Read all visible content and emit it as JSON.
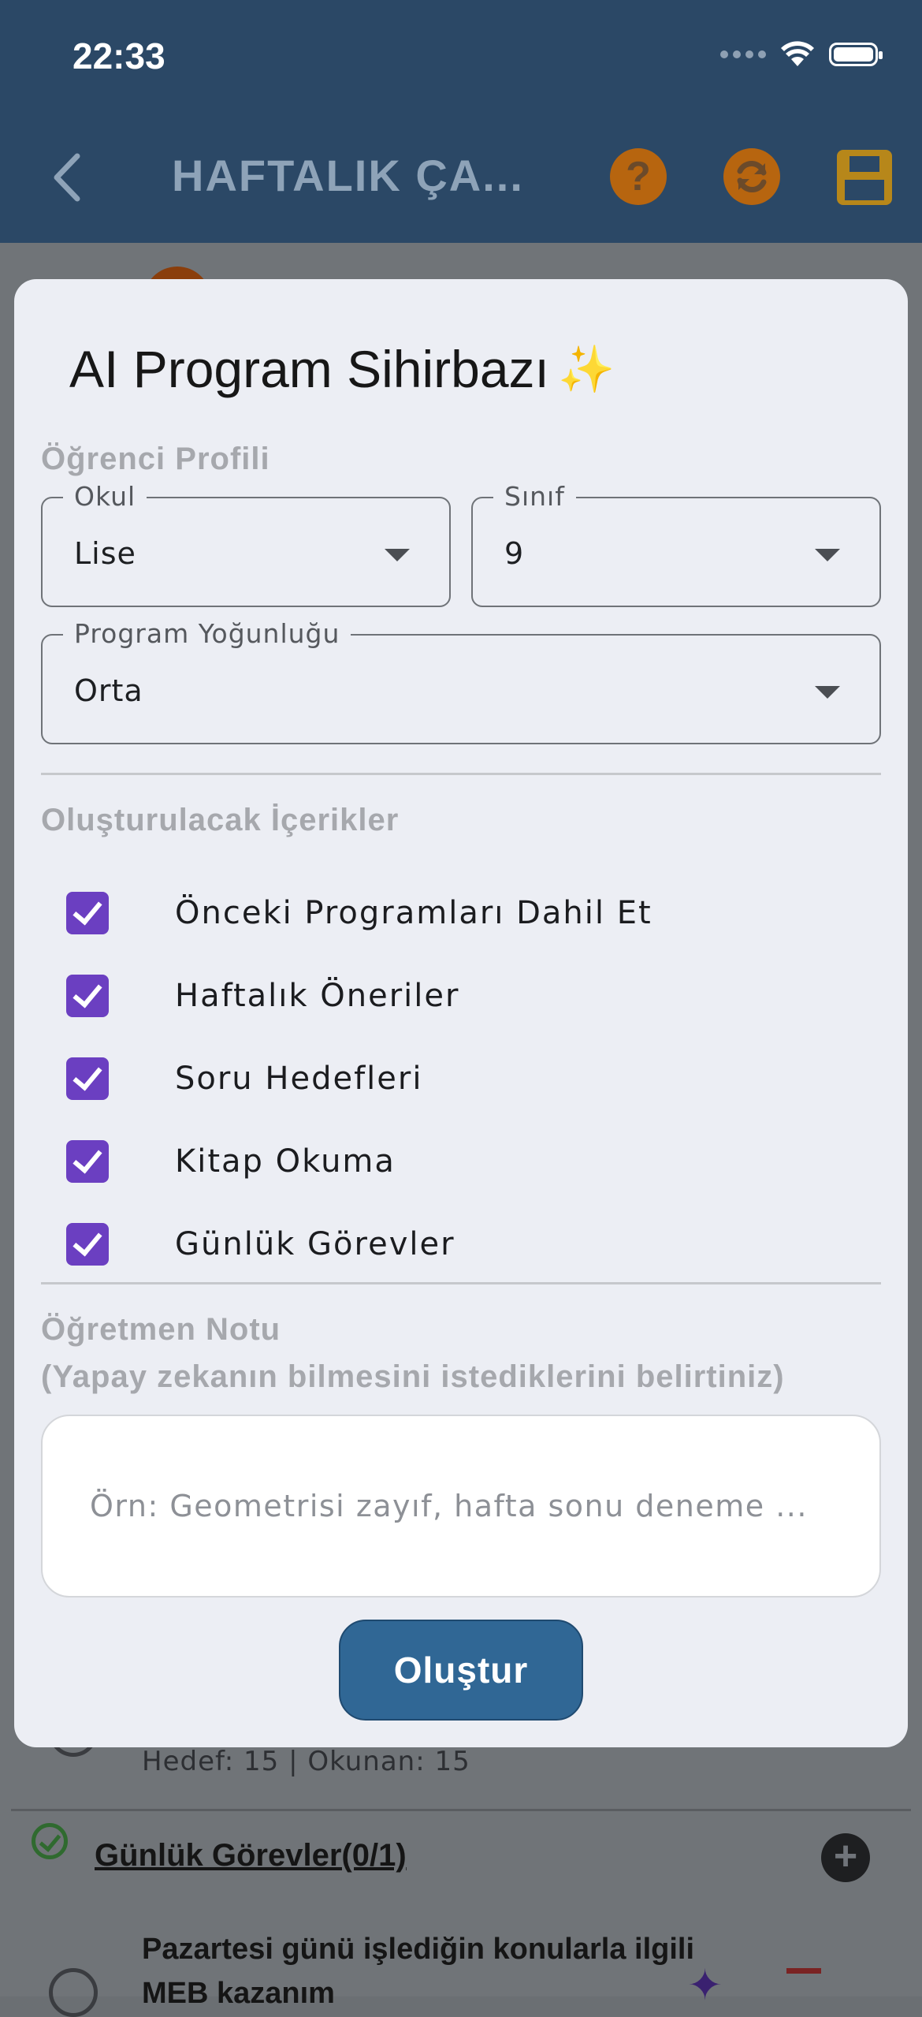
{
  "status_bar": {
    "time": "22:33"
  },
  "app_bar": {
    "title": "HAFTALIK ÇA...",
    "help_glyph": "?",
    "icons": [
      "back-chevron-icon",
      "help-icon",
      "sync-icon",
      "save-icon"
    ]
  },
  "modal": {
    "title": "AI Program Sihirbazı",
    "title_emoji": "✨",
    "student_profile": {
      "section_label": "Öğrenci Profili",
      "school": {
        "label": "Okul",
        "value": "Lise"
      },
      "grade": {
        "label": "Sınıf",
        "value": "9"
      },
      "intensity": {
        "label": "Program Yoğunluğu",
        "value": "Orta"
      }
    },
    "contents": {
      "section_label": "Oluşturulacak İçerikler",
      "items": [
        {
          "label": "Önceki Programları Dahil Et",
          "checked": true
        },
        {
          "label": "Haftalık Öneriler",
          "checked": true
        },
        {
          "label": "Soru Hedefleri",
          "checked": true
        },
        {
          "label": "Kitap Okuma",
          "checked": true
        },
        {
          "label": "Günlük Görevler",
          "checked": true
        }
      ]
    },
    "teacher_note": {
      "label_line1": "Öğretmen Notu",
      "label_line2": "(Yapay zekanın bilmesini istediklerini belirtiniz)",
      "placeholder": "Örn: Geometrisi zayıf, hafta sonu deneme ..."
    },
    "create_button": "Oluştur"
  },
  "background_page": {
    "target_text": "Hedef: 15 | Okunan: 15",
    "daily_tasks_title": "Günlük Görevler(0/1)",
    "add_glyph": "+",
    "task_text": "Pazartesi günü işlediğin konularla ilgili MEB kazanım",
    "colors": {
      "accent_purple": "#6b3fc1",
      "primary_blue": "#306795",
      "app_bar": "#2b4866",
      "orange_button": "#b7650f"
    }
  }
}
